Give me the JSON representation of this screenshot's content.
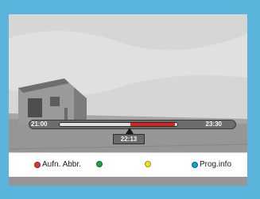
{
  "timeline": {
    "start": "21:00",
    "end": "23:30",
    "current": "22:13",
    "recorded_from": 0.6,
    "recorded_to": 0.98,
    "cursor_position": 0.59
  },
  "color_buttons": [
    {
      "color": "#e63232",
      "label": "Aufn. Abbr."
    },
    {
      "color": "#1aa54a",
      "label": ""
    },
    {
      "color": "#f3e21e",
      "label": ""
    },
    {
      "color": "#1a9ce0",
      "label": "Prog.info"
    }
  ]
}
